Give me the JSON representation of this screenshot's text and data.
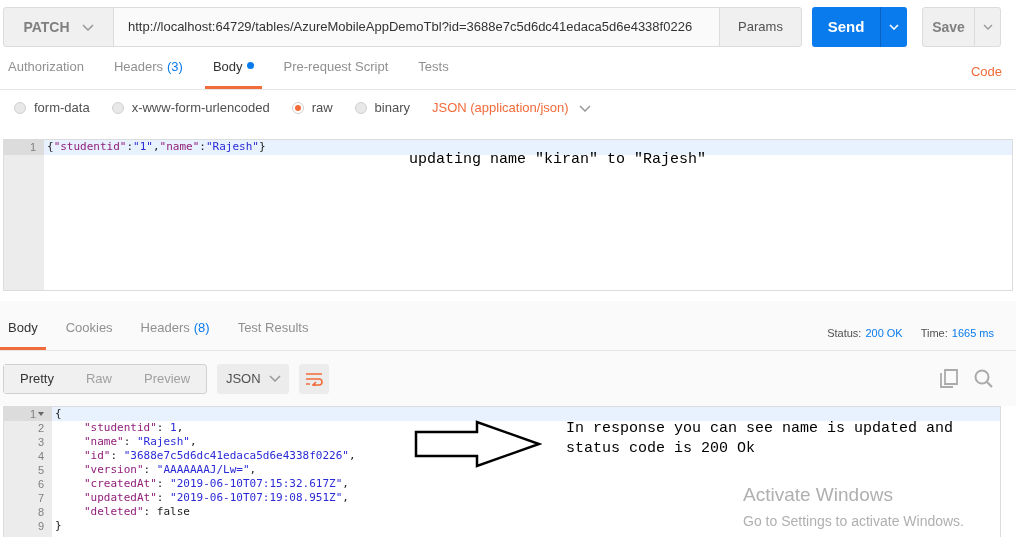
{
  "request_bar": {
    "method": "PATCH",
    "url": "http://localhost:64729/tables/AzureMobileAppDemoTbl?id=3688e7c5d6dc41edaca5d6e4338f0226",
    "params_button": "Params",
    "send_button": "Send",
    "save_button": "Save"
  },
  "request_tabs": [
    {
      "label": "Authorization",
      "selected": false
    },
    {
      "label": "Headers",
      "count": "(3)",
      "selected": false
    },
    {
      "label": "Body",
      "selected": true,
      "dot": true
    },
    {
      "label": "Pre-request Script",
      "selected": false
    },
    {
      "label": "Tests",
      "selected": false
    }
  ],
  "code_link": "Code",
  "body_types": [
    {
      "label": "form-data",
      "selected": false
    },
    {
      "label": "x-www-form-urlencoded",
      "selected": false
    },
    {
      "label": "raw",
      "selected": true
    },
    {
      "label": "binary",
      "selected": false
    }
  ],
  "content_type": "JSON (application/json)",
  "request_editor": {
    "lines": [
      {
        "number": "1",
        "indented": false,
        "tokens": [
          {
            "kind": "punct",
            "text": "{"
          },
          {
            "kind": "key",
            "text": "\"studentid\""
          },
          {
            "kind": "punct",
            "text": ":"
          },
          {
            "kind": "string",
            "text": "\"1\""
          },
          {
            "kind": "punct",
            "text": ","
          },
          {
            "kind": "key",
            "text": "\"name\""
          },
          {
            "kind": "punct",
            "text": ":"
          },
          {
            "kind": "string",
            "text": "\"Rajesh\""
          },
          {
            "kind": "punct",
            "text": "}"
          }
        ]
      }
    ],
    "annotation": "updating name \"kiran\" to \"Rajesh\""
  },
  "response_tabs": [
    {
      "label": "Body",
      "selected": true
    },
    {
      "label": "Cookies",
      "selected": false
    },
    {
      "label": "Headers",
      "count": "(8)",
      "selected": false
    },
    {
      "label": "Test Results",
      "selected": false
    }
  ],
  "status": {
    "label": "Status:",
    "value": "200 OK"
  },
  "time": {
    "label": "Time:",
    "value": "1665 ms"
  },
  "view_modes": [
    {
      "label": "Pretty",
      "selected": true
    },
    {
      "label": "Raw",
      "selected": false
    },
    {
      "label": "Preview",
      "selected": false
    }
  ],
  "format_select": "JSON",
  "response_editor": {
    "lines": [
      {
        "number": "1",
        "indented": false,
        "foldable": true,
        "tokens": [
          {
            "kind": "punct",
            "text": "{"
          }
        ]
      },
      {
        "number": "2",
        "indented": true,
        "tokens": [
          {
            "kind": "key",
            "text": "\"studentid\""
          },
          {
            "kind": "punct",
            "text": ": "
          },
          {
            "kind": "number",
            "text": "1"
          },
          {
            "kind": "punct",
            "text": ","
          }
        ]
      },
      {
        "number": "3",
        "indented": true,
        "tokens": [
          {
            "kind": "key",
            "text": "\"name\""
          },
          {
            "kind": "punct",
            "text": ": "
          },
          {
            "kind": "string",
            "text": "\"Rajesh\""
          },
          {
            "kind": "punct",
            "text": ","
          }
        ]
      },
      {
        "number": "4",
        "indented": true,
        "tokens": [
          {
            "kind": "key",
            "text": "\"id\""
          },
          {
            "kind": "punct",
            "text": ": "
          },
          {
            "kind": "string",
            "text": "\"3688e7c5d6dc41edaca5d6e4338f0226\""
          },
          {
            "kind": "punct",
            "text": ","
          }
        ]
      },
      {
        "number": "5",
        "indented": true,
        "tokens": [
          {
            "kind": "key",
            "text": "\"version\""
          },
          {
            "kind": "punct",
            "text": ": "
          },
          {
            "kind": "string",
            "text": "\"AAAAAAAJ/Lw=\""
          },
          {
            "kind": "punct",
            "text": ","
          }
        ]
      },
      {
        "number": "6",
        "indented": true,
        "tokens": [
          {
            "kind": "key",
            "text": "\"createdAt\""
          },
          {
            "kind": "punct",
            "text": ": "
          },
          {
            "kind": "string",
            "text": "\"2019-06-10T07:15:32.617Z\""
          },
          {
            "kind": "punct",
            "text": ","
          }
        ]
      },
      {
        "number": "7",
        "indented": true,
        "tokens": [
          {
            "kind": "key",
            "text": "\"updatedAt\""
          },
          {
            "kind": "punct",
            "text": ": "
          },
          {
            "kind": "string",
            "text": "\"2019-06-10T07:19:08.951Z\""
          },
          {
            "kind": "punct",
            "text": ","
          }
        ]
      },
      {
        "number": "8",
        "indented": true,
        "tokens": [
          {
            "kind": "key",
            "text": "\"deleted\""
          },
          {
            "kind": "punct",
            "text": ": "
          },
          {
            "kind": "literal",
            "text": "false"
          }
        ]
      },
      {
        "number": "9",
        "indented": false,
        "tokens": [
          {
            "kind": "punct",
            "text": "}"
          }
        ]
      }
    ],
    "annotation": "In response you can see name is updated and status code is 200 Ok"
  },
  "os_notice": {
    "title": "Activate Windows",
    "subtitle": "Go to Settings to activate Windows."
  }
}
